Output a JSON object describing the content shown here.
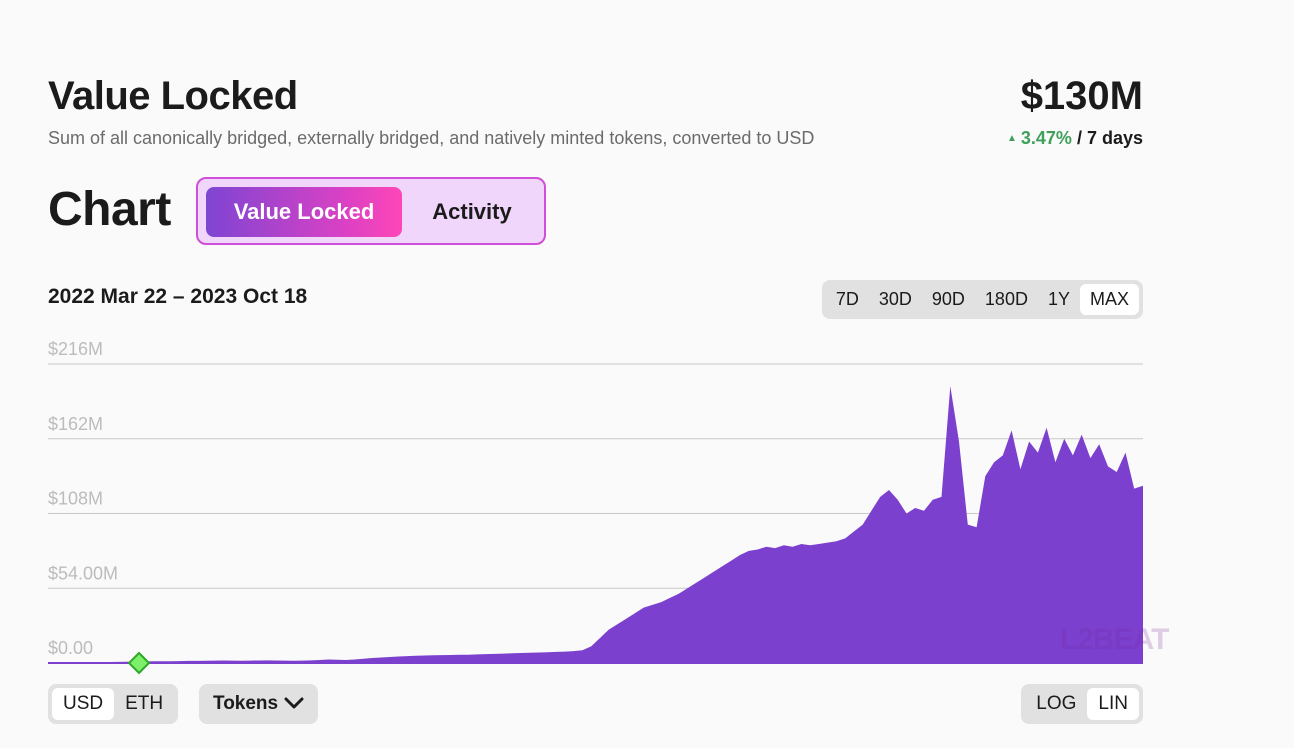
{
  "header": {
    "title": "Value Locked",
    "subtitle": "Sum of all canonically bridged, externally bridged, and natively minted tokens, converted to USD",
    "value": "$130M",
    "change": "3.47%",
    "change_period": "/ 7 days",
    "change_color": "#3ea05a"
  },
  "chart_section": {
    "title": "Chart",
    "tabs": [
      "Value Locked",
      "Activity"
    ],
    "active_tab": "Value Locked",
    "range_label": "2022 Mar 22 – 2023 Oct 18",
    "ranges": [
      "7D",
      "30D",
      "90D",
      "180D",
      "1Y",
      "MAX"
    ],
    "selected_range": "MAX",
    "watermark": "L2BEAT"
  },
  "controls": {
    "currency": [
      "USD",
      "ETH"
    ],
    "selected_currency": "USD",
    "tokens_label": "Tokens",
    "scales": [
      "LOG",
      "LIN"
    ],
    "selected_scale": "LIN"
  },
  "chart_data": {
    "type": "area",
    "ylim": [
      0,
      216
    ],
    "y_ticks": [
      "$216M",
      "$162M",
      "$108M",
      "$54.00M",
      "$0.00"
    ],
    "x_range": [
      "2022-03-22",
      "2023-10-18"
    ],
    "fill_color": "#7c40cf",
    "grid": true,
    "values": [
      0.2,
      0.3,
      0.4,
      0.4,
      0.5,
      0.6,
      0.6,
      0.7,
      0.8,
      0.9,
      1.0,
      1.1,
      1.2,
      1.2,
      1.3,
      1.4,
      1.5,
      1.5,
      1.6,
      1.7,
      1.8,
      1.7,
      1.6,
      1.7,
      1.8,
      1.9,
      1.8,
      1.7,
      1.6,
      1.7,
      1.9,
      2.2,
      2.5,
      2.3,
      2.2,
      2.5,
      3.0,
      3.6,
      4.0,
      4.3,
      4.7,
      5.0,
      5.2,
      5.4,
      5.6,
      5.7,
      5.8,
      5.9,
      6.0,
      6.2,
      6.4,
      6.6,
      6.8,
      7.0,
      7.2,
      7.4,
      7.6,
      7.8,
      8.0,
      8.2,
      8.6,
      9.2,
      12,
      18,
      24,
      28,
      32,
      36,
      40,
      42,
      44,
      47,
      50,
      54,
      58,
      62,
      66,
      70,
      74,
      78,
      81,
      82,
      84,
      83,
      85,
      84,
      86,
      85,
      86,
      87,
      88,
      90,
      95,
      100,
      110,
      120,
      125,
      118,
      108,
      112,
      110,
      118,
      120,
      200,
      160,
      100,
      98,
      135,
      145,
      150,
      168,
      140,
      160,
      152,
      170,
      145,
      162,
      150,
      165,
      148,
      158,
      142,
      138,
      152,
      126,
      128
    ]
  }
}
